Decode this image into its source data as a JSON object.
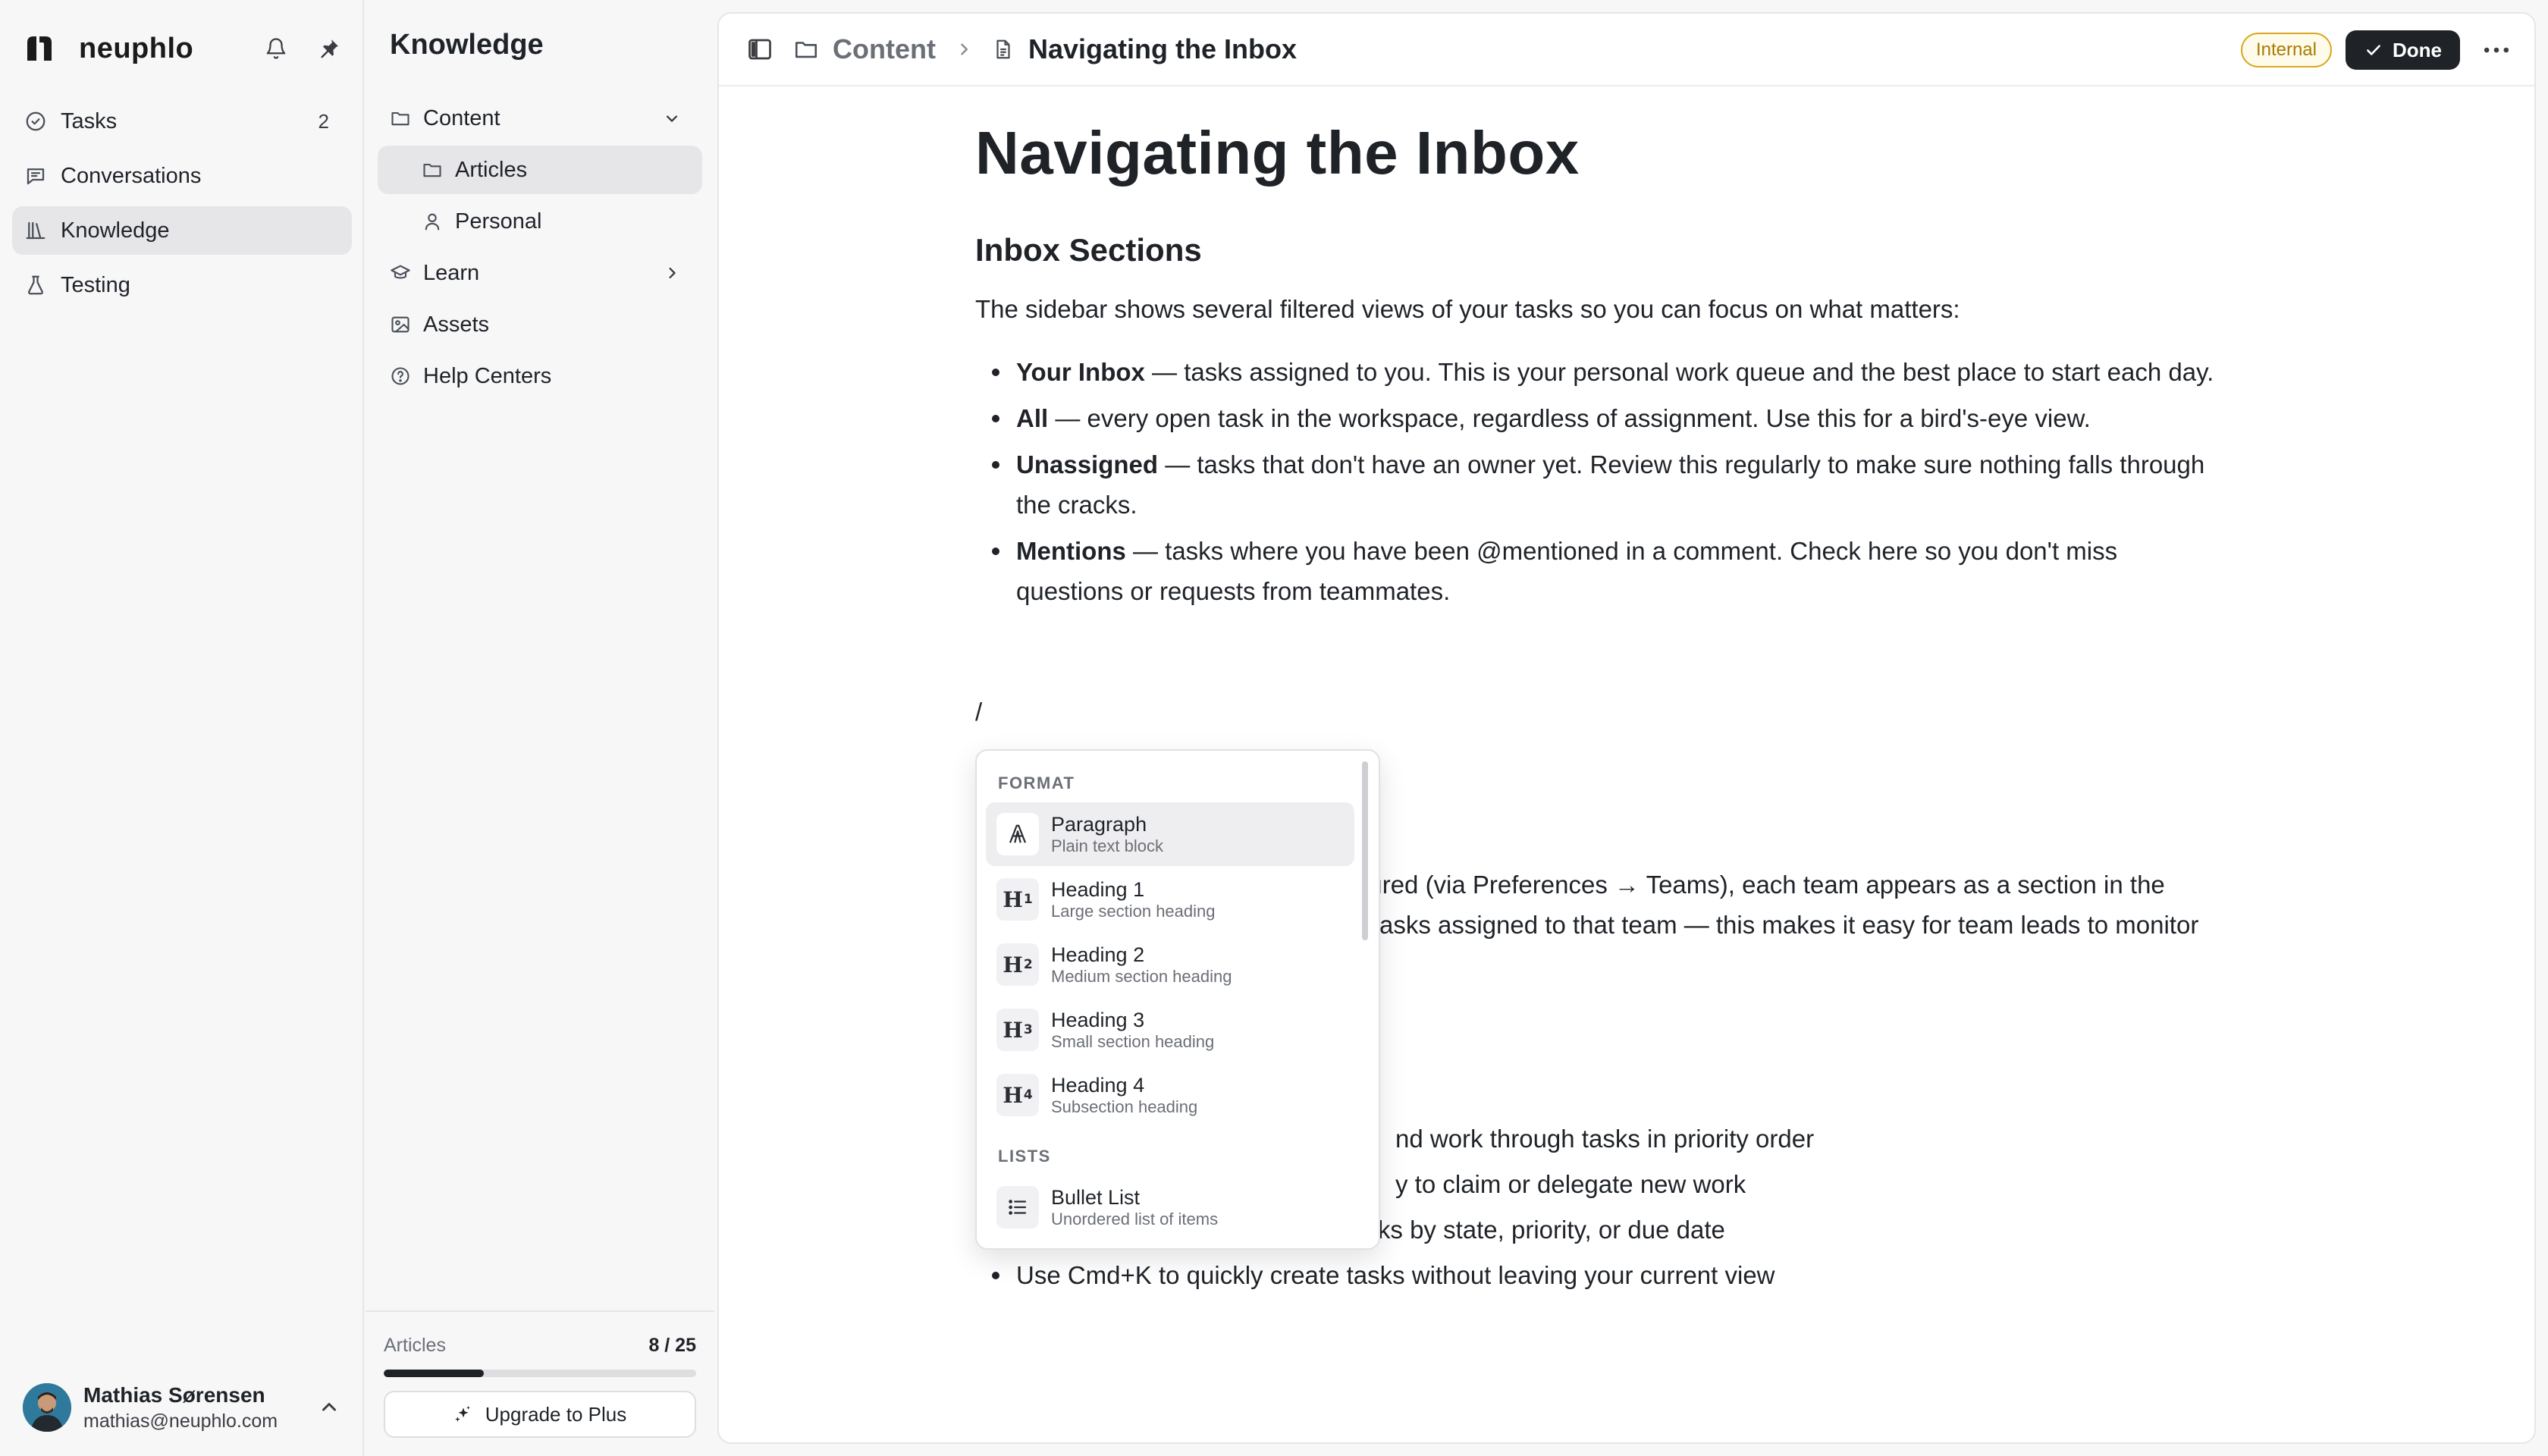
{
  "brand": {
    "name": "neuphlo"
  },
  "nav": {
    "items": [
      {
        "label": "Tasks",
        "count": "2"
      },
      {
        "label": "Conversations"
      },
      {
        "label": "Knowledge"
      },
      {
        "label": "Testing"
      }
    ],
    "active": "Knowledge"
  },
  "user": {
    "name": "Mathias Sørensen",
    "email": "mathias@neuphlo.com"
  },
  "knowledge": {
    "title": "Knowledge",
    "tree": [
      {
        "label": "Content"
      },
      {
        "label": "Articles"
      },
      {
        "label": "Personal"
      },
      {
        "label": "Learn"
      },
      {
        "label": "Assets"
      },
      {
        "label": "Help Centers"
      }
    ],
    "quota": {
      "label": "Articles",
      "value": "8 / 25",
      "used": 8,
      "total": 25
    },
    "upgrade_label": "Upgrade to Plus"
  },
  "topbar": {
    "crumb_parent": "Content",
    "crumb_current": "Navigating the Inbox",
    "badge": "Internal",
    "done_label": "Done"
  },
  "doc": {
    "title": "Navigating the Inbox",
    "section1": "Inbox Sections",
    "intro": "The sidebar shows several filtered views of your tasks so you can focus on what matters:",
    "bullets": [
      {
        "term": "Your Inbox",
        "text": " — tasks assigned to you. This is your personal work queue and the best place to start each day."
      },
      {
        "term": "All",
        "text": " — every open task in the workspace, regardless of assignment. Use this for a bird's-eye view."
      },
      {
        "term": "Unassigned",
        "text": " — tasks that don't have an owner yet. Review this regularly to make sure nothing falls through the cracks."
      },
      {
        "term": "Mentions",
        "text": " — tasks where you have been @mentioned in a comment. Check here so you don't miss questions or requests from teammates."
      }
    ],
    "slash": "/",
    "behind_para_line1": "gured (via Preferences → Teams), each team appears as a section in the",
    "behind_para_line2": "ll tasks assigned to that team — this makes it easy for team leads to monitor",
    "behind_bullets": [
      "nd work through tasks in priority order",
      "y to claim or delegate new work",
      "Use the column sort to group tasks by state, priority, or due date",
      "Use Cmd+K to quickly create tasks without leaving your current view"
    ]
  },
  "menu": {
    "section_format": "FORMAT",
    "section_lists": "LISTS",
    "items": [
      {
        "title": "Paragraph",
        "sub": "Plain text block"
      },
      {
        "title": "Heading 1",
        "sub": "Large section heading"
      },
      {
        "title": "Heading 2",
        "sub": "Medium section heading"
      },
      {
        "title": "Heading 3",
        "sub": "Small section heading"
      },
      {
        "title": "Heading 4",
        "sub": "Subsection heading"
      },
      {
        "title": "Bullet List",
        "sub": "Unordered list of items"
      }
    ]
  }
}
